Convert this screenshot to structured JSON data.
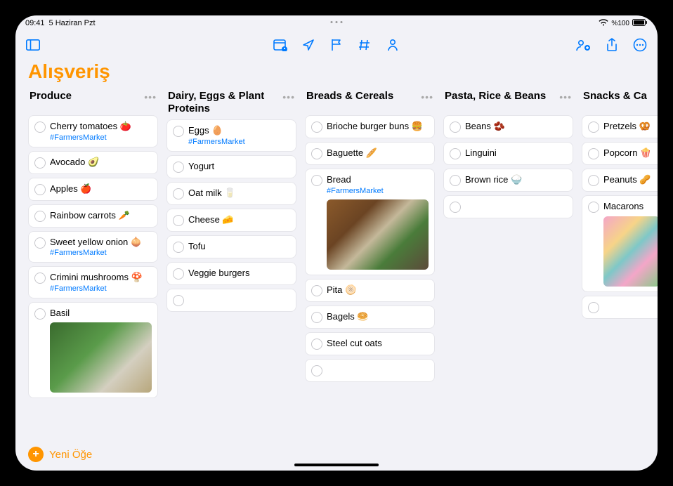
{
  "status": {
    "time": "09:41",
    "date": "5 Haziran Pzt",
    "battery": "%100"
  },
  "title": "Alışveriş",
  "addButton": "Yeni Öğe",
  "columns": [
    {
      "title": "Produce",
      "items": [
        {
          "text": "Cherry tomatoes 🍅",
          "tag": "#FarmersMarket"
        },
        {
          "text": "Avocado 🥑"
        },
        {
          "text": "Apples 🍎"
        },
        {
          "text": "Rainbow carrots 🥕"
        },
        {
          "text": "Sweet yellow onion 🧅",
          "tag": "#FarmersMarket"
        },
        {
          "text": "Crimini mushrooms 🍄",
          "tag": "#FarmersMarket"
        },
        {
          "text": "Basil",
          "image": "basil"
        }
      ]
    },
    {
      "title": "Dairy, Eggs & Plant Proteins",
      "items": [
        {
          "text": "Eggs 🥚",
          "tag": "#FarmersMarket"
        },
        {
          "text": "Yogurt"
        },
        {
          "text": "Oat milk 🥛"
        },
        {
          "text": "Cheese 🧀"
        },
        {
          "text": "Tofu"
        },
        {
          "text": "Veggie burgers"
        },
        {
          "empty": true
        }
      ]
    },
    {
      "title": "Breads & Cereals",
      "items": [
        {
          "text": "Brioche burger buns 🍔"
        },
        {
          "text": "Baguette 🥖"
        },
        {
          "text": "Bread",
          "tag": "#FarmersMarket",
          "image": "bread"
        },
        {
          "text": "Pita 🫓"
        },
        {
          "text": "Bagels 🥯"
        },
        {
          "text": "Steel cut oats"
        },
        {
          "empty": true
        }
      ]
    },
    {
      "title": "Pasta, Rice & Beans",
      "items": [
        {
          "text": "Beans 🫘"
        },
        {
          "text": "Linguini"
        },
        {
          "text": "Brown rice 🍚"
        },
        {
          "empty": true
        }
      ]
    },
    {
      "title": "Snacks & Ca",
      "partial": true,
      "items": [
        {
          "text": "Pretzels 🥨"
        },
        {
          "text": "Popcorn 🍿"
        },
        {
          "text": "Peanuts 🥜"
        },
        {
          "text": "Macarons",
          "image": "macarons"
        },
        {
          "empty": true
        }
      ]
    }
  ]
}
